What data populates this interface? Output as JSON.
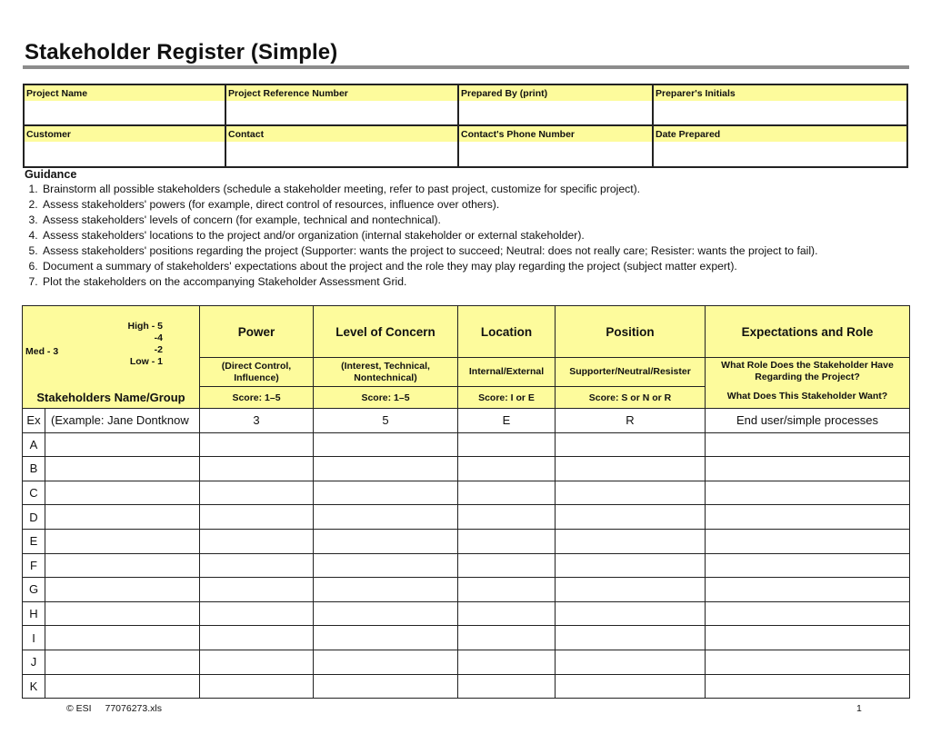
{
  "title": "Stakeholder Register (Simple)",
  "colors": {
    "header_fill": "#fdfb9c",
    "rule": "#8c8c8c",
    "border": "#222222"
  },
  "info_fields": [
    {
      "label": "Project Name",
      "value": ""
    },
    {
      "label": "Project Reference Number",
      "value": ""
    },
    {
      "label": "Prepared By (print)",
      "value": ""
    },
    {
      "label": "Preparer's Initials",
      "value": ""
    },
    {
      "label": "Customer",
      "value": ""
    },
    {
      "label": "Contact",
      "value": ""
    },
    {
      "label": "Contact's Phone Number",
      "value": ""
    },
    {
      "label": "Date Prepared",
      "value": ""
    }
  ],
  "guidance": {
    "title": "Guidance",
    "items": [
      "Brainstorm all possible stakeholders (schedule a stakeholder meeting, refer to past project, customize for specific project).",
      "Assess stakeholders' powers (for example, direct control of resources, influence over others).",
      "Assess stakeholders' levels of concern (for example, technical and nontechnical).",
      "Assess stakeholders' locations to the project and/or organization (internal stakeholder or external stakeholder).",
      "Assess stakeholders' positions regarding the project (Supporter: wants the project to succeed; Neutral: does not really care; Resister: wants the project to fail).",
      "Document a summary of stakeholders' expectations about the project and the role they may play regarding the project (subject matter expert).",
      "Plot the stakeholders on the accompanying Stakeholder Assessment Grid."
    ]
  },
  "register": {
    "legend": {
      "high": "High - 5",
      "four": "-4",
      "two": "-2",
      "low": "Low - 1",
      "med": "Med - 3",
      "name_header": "Stakeholders Name/Group"
    },
    "columns": [
      {
        "title": "Power",
        "sub": "(Direct Control, Influence)",
        "score": "Score: 1–5"
      },
      {
        "title": "Level of Concern",
        "sub": "(Interest, Technical, Nontechnical)",
        "score": "Score: 1–5"
      },
      {
        "title": "Location",
        "sub": "Internal/External",
        "score": "Score: I or E"
      },
      {
        "title": "Position",
        "sub": "Supporter/Neutral/Resister",
        "score": "Score: S or N or R"
      },
      {
        "title": "Expectations and Role",
        "sub": "What Role Does the Stakeholder Have Regarding the Project?",
        "score": "What Does This Stakeholder Want?"
      }
    ],
    "rows": [
      {
        "label": "Ex",
        "name": "(Example: Jane Dontknow",
        "power": "3",
        "concern": "5",
        "location": "E",
        "position": "R",
        "expectations": "End user/simple processes"
      },
      {
        "label": "A",
        "name": "",
        "power": "",
        "concern": "",
        "location": "",
        "position": "",
        "expectations": ""
      },
      {
        "label": "B",
        "name": "",
        "power": "",
        "concern": "",
        "location": "",
        "position": "",
        "expectations": ""
      },
      {
        "label": "C",
        "name": "",
        "power": "",
        "concern": "",
        "location": "",
        "position": "",
        "expectations": ""
      },
      {
        "label": "D",
        "name": "",
        "power": "",
        "concern": "",
        "location": "",
        "position": "",
        "expectations": ""
      },
      {
        "label": "E",
        "name": "",
        "power": "",
        "concern": "",
        "location": "",
        "position": "",
        "expectations": ""
      },
      {
        "label": "F",
        "name": "",
        "power": "",
        "concern": "",
        "location": "",
        "position": "",
        "expectations": ""
      },
      {
        "label": "G",
        "name": "",
        "power": "",
        "concern": "",
        "location": "",
        "position": "",
        "expectations": ""
      },
      {
        "label": "H",
        "name": "",
        "power": "",
        "concern": "",
        "location": "",
        "position": "",
        "expectations": ""
      },
      {
        "label": "I",
        "name": "",
        "power": "",
        "concern": "",
        "location": "",
        "position": "",
        "expectations": ""
      },
      {
        "label": "J",
        "name": "",
        "power": "",
        "concern": "",
        "location": "",
        "position": "",
        "expectations": ""
      },
      {
        "label": "K",
        "name": "",
        "power": "",
        "concern": "",
        "location": "",
        "position": "",
        "expectations": ""
      }
    ]
  },
  "footer": {
    "copyright": "© ESI",
    "filename": "77076273.xls",
    "page": "1"
  }
}
